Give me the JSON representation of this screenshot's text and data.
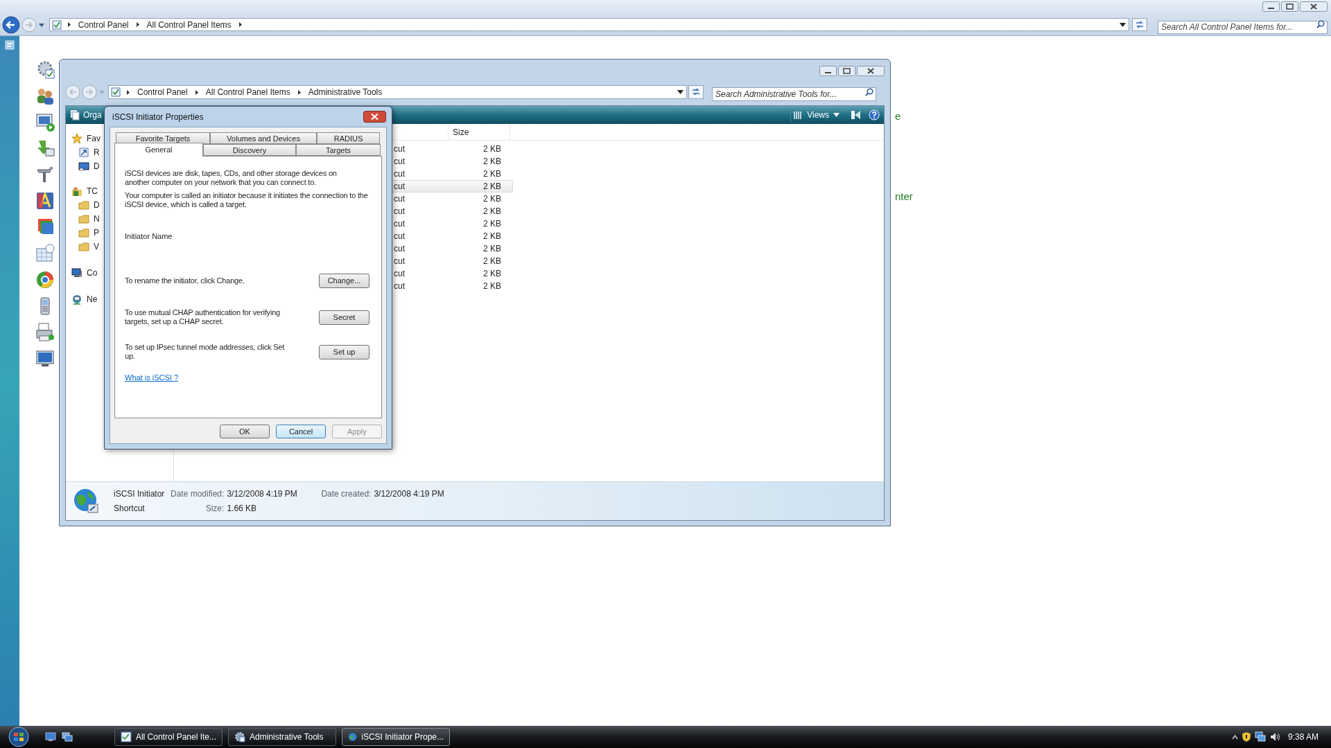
{
  "back_window": {
    "crumbs": [
      "Control Panel",
      "All Control Panel Items"
    ],
    "search": {
      "placeholder": "Search All Control Panel Items for..."
    },
    "partial_texts": [
      "e",
      "nter"
    ]
  },
  "admin_window": {
    "crumbs": [
      "Control Panel",
      "All Control Panel Items",
      "Administrative Tools"
    ],
    "search": {
      "placeholder": "Search Administrative Tools for..."
    },
    "toolbar": {
      "organize": "Orga",
      "views": "Views"
    },
    "nav": [
      {
        "label": "Fav",
        "kind": "star",
        "children": [
          {
            "label": "R",
            "kind": "shortcut"
          },
          {
            "label": "D",
            "kind": "desktop"
          }
        ]
      },
      {
        "label": "TC",
        "kind": "user",
        "children": [
          {
            "label": "D",
            "kind": "folder"
          },
          {
            "label": "N",
            "kind": "folder"
          },
          {
            "label": "P",
            "kind": "folder"
          },
          {
            "label": "V",
            "kind": "folder"
          }
        ]
      },
      {
        "label": "Co",
        "kind": "computer"
      },
      {
        "label": "Ne",
        "kind": "network"
      }
    ],
    "columns": [
      "Size"
    ],
    "rows": [
      {
        "type": "cut",
        "size": "2 KB",
        "selected": false
      },
      {
        "type": "cut",
        "size": "2 KB",
        "selected": false
      },
      {
        "type": "cut",
        "size": "2 KB",
        "selected": false
      },
      {
        "type": "cut",
        "size": "2 KB",
        "selected": true
      },
      {
        "type": "cut",
        "size": "2 KB",
        "selected": false
      },
      {
        "type": "cut",
        "size": "2 KB",
        "selected": false
      },
      {
        "type": "cut",
        "size": "2 KB",
        "selected": false
      },
      {
        "type": "cut",
        "size": "2 KB",
        "selected": false
      },
      {
        "type": "cut",
        "size": "2 KB",
        "selected": false
      },
      {
        "type": "cut",
        "size": "2 KB",
        "selected": false
      },
      {
        "type": "cut",
        "size": "2 KB",
        "selected": false
      },
      {
        "type": "cut",
        "size": "2 KB",
        "selected": false
      }
    ],
    "details": {
      "name": "iSCSI Initiator",
      "type": "Shortcut",
      "fields": [
        {
          "label": "Date modified:",
          "value": "3/12/2008 4:19 PM"
        },
        {
          "label": "Size:",
          "value": "1.66 KB"
        },
        {
          "label": "Date created:",
          "value": "3/12/2008 4:19 PM"
        }
      ]
    }
  },
  "dialog": {
    "title": "iSCSI Initiator Properties",
    "tab_rows": [
      [
        {
          "label": "Favorite Targets",
          "selected": false
        },
        {
          "label": "Volumes and Devices",
          "selected": false
        },
        {
          "label": "RADIUS",
          "selected": false
        }
      ],
      [
        {
          "label": "General",
          "selected": true
        },
        {
          "label": "Discovery",
          "selected": false
        },
        {
          "label": "Targets",
          "selected": false
        }
      ]
    ],
    "intro": [
      "iSCSI devices are disk, tapes, CDs, and other storage devices on another computer on your network that you can connect to.",
      "Your computer is called an initiator because it initiates the connection to the iSCSI device, which is called a target."
    ],
    "initiator_label": "Initiator Name",
    "actions": [
      {
        "text": "To rename the initiator, click Change.",
        "button": "Change..."
      },
      {
        "text": "To use mutual CHAP authentication for verifying targets, set up a CHAP secret.",
        "button": "Secret"
      },
      {
        "text": "To set up IPsec tunnel mode addresses, click Set up.",
        "button": "Set up"
      }
    ],
    "link": "What is iSCSI ?",
    "buttons": [
      {
        "label": "OK",
        "disabled": false,
        "default": false
      },
      {
        "label": "Cancel",
        "disabled": false,
        "default": true
      },
      {
        "label": "Apply",
        "disabled": true,
        "default": false
      }
    ]
  },
  "taskbar": {
    "tasks": [
      {
        "label": "All Control Panel Ite...",
        "selected": false
      },
      {
        "label": "Administrative Tools",
        "selected": false
      },
      {
        "label": "iSCSI Initiator Prope...",
        "selected": true
      }
    ],
    "clock": "9:38 AM"
  }
}
